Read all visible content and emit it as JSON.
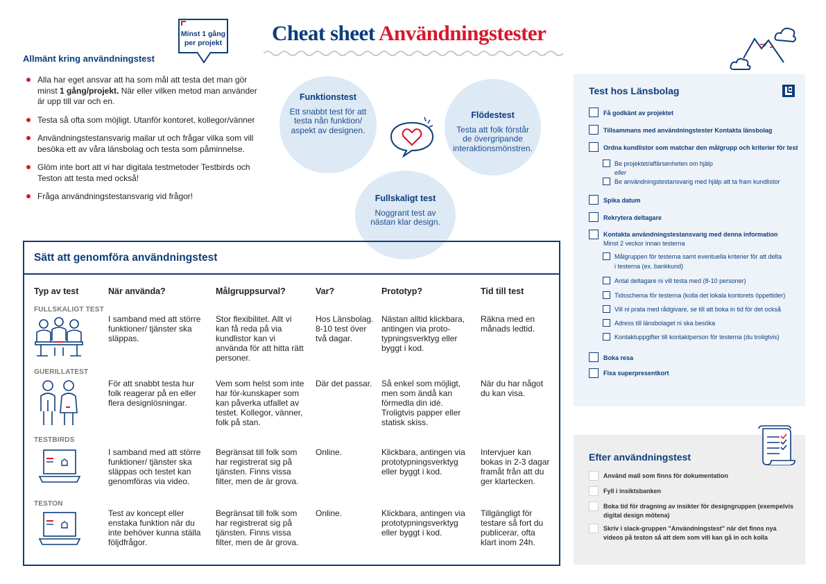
{
  "badge": {
    "line1": "Minst 1 gång",
    "line2": "per projekt"
  },
  "title": {
    "part1": "Cheat sheet",
    "part2": "Användningstester"
  },
  "general": {
    "title": "Allmänt kring användningstest",
    "b1_pre": "Alla har eget ansvar att ha som mål att testa det man gör minst ",
    "b1_bold": "1 gång/projekt.",
    "b1_post": " När eller vilken metod man använder är upp till var och en.",
    "b2": "Testa så ofta som möjligt. Utanför kontoret, kollegor/vänner",
    "b3": "Användningstestansvarig mailar ut och frågar vilka som vill besöka ett av våra länsbolag och testa som påminnelse.",
    "b4": "Glöm inte bort att vi har digitala testmetoder Testbirds och Teston att testa med också!",
    "b5": "Fråga användningstestansvarig vid frågor!"
  },
  "circles": {
    "funktion": {
      "title": "Funktionstest",
      "text": "Ett snabbt test för att testa nån funktion/ aspekt av designen."
    },
    "flode": {
      "title": "Flödestest",
      "text": "Testa att folk förstår de övergripande interaktionsmönstren."
    },
    "full": {
      "title": "Fullskaligt test",
      "text": "Noggrant test av nästan klar design."
    }
  },
  "method": {
    "title": "Sätt att genomföra användningstest",
    "headers": [
      "Typ av test",
      "När använda?",
      "Målgruppsurval?",
      "Var?",
      "Prototyp?",
      "Tid till test"
    ],
    "rows": [
      {
        "label": "FULLSKALIGT TEST",
        "icon": "people-at-table-icon",
        "nar": "I samband med att större funktioner/ tjänster ska släppas.",
        "malgrupp": "Stor flexibilitet. Allt vi kan få reda på via kundlistor kan vi använda för att hitta rätt personer.",
        "var": "Hos Länsbolag. 8-10 test över två dagar.",
        "prototyp": "Nästan alltid klickbara, antingen via proto-typningsverktyg eller byggt i kod.",
        "tid": "Räkna med en månads ledtid."
      },
      {
        "label": "GUERILLATEST",
        "icon": "two-people-icon",
        "nar": "För att snabbt testa hur folk reagerar på en eller flera designlösningar.",
        "malgrupp": "Vem som helst som inte har för-kunskaper som kan påverka utfallet av testet. Kollegor, vänner, folk på stan.",
        "var": "Där det passar.",
        "prototyp": "Så enkel som möjligt, men som ändå kan förmedla din idé. Troligtvis papper eller statisk skiss.",
        "tid": "När du har något du kan visa."
      },
      {
        "label": "TESTBIRDS",
        "icon": "laptop-icon",
        "nar": "I samband med att större funktioner/ tjänster ska släppas och testet  kan genomföras via video.",
        "malgrupp": "Begränsat till folk som har registrerat sig på tjänsten. Finns vissa filter, men de är grova.",
        "var": "Online.",
        "prototyp": "Klickbara, antingen via prototypningsverktyg eller byggt i kod.",
        "tid": "Intervjuer kan bokas in 2-3 dagar framåt från att du ger klartecken."
      },
      {
        "label": "TESTON",
        "icon": "laptop-icon",
        "nar": "Test av koncept eller enstaka funktion när du inte behöver kunna ställa följdfrågor.",
        "malgrupp": "Begränsat till folk som har registrerat sig på tjänsten. Finns vissa filter, men de är grova.",
        "var": "Online.",
        "prototyp": "Klickbara, antingen via prototypningsverktyg eller byggt i kod.",
        "tid": "Tillgängligt för testare så fort du publicerar, ofta klart inom 24h."
      }
    ]
  },
  "lansbolag": {
    "title": "Test hos Länsbolag",
    "i1": "Få godkänt av projektet",
    "i2": "Tillsammans med användningstester Kontakta länsbolag",
    "i3": "Ordna kundlistor som matchar den målgrupp och kriterier för test",
    "i3a": "Be projektet/affärsenheten om hjälp",
    "eller": "eller",
    "i3b": "Be användningstestansvarig med hjälp att ta fram kundlistor",
    "i4": "Spika datum",
    "i5": "Rekrytera deltagare",
    "i6": "Kontakta användningstestansvarig med denna information",
    "i6note": "Minst 2 veckor innan testerna",
    "i6a1": "Målgruppen för testerna samt eventuella kriterier för att delta",
    "i6a2": "i testerna (ex. bankkund)",
    "i6b": "Antal deltagare ni vill testa med (8-10 personer)",
    "i6c": "Tidsschema för testerna (kolla det lokala kontorets öppettider)",
    "i6d": "Vill ni prata med rådgivare, se till att boka in tid för det också",
    "i6e": "Adress till länsbolaget ni ska besöka",
    "i6f": "Kontaktuppgifter till kontaktperson för testerna (du troligtvis)",
    "i7": "Boka resa",
    "i8": "Fixa superpresentkort"
  },
  "efter": {
    "title": "Efter användningstest",
    "i1": "Använd mall som finns för dokumentation",
    "i2": "Fyll i insiktsbanken",
    "i3a": "Boka tid för dragning av insikter för designgruppen (exempelvis",
    "i3b": "digital design mötena)",
    "i4a": "Skriv i slack-gruppen \"Användningstest\" när det finns nya",
    "i4b": "videos på teston så att dem som vill kan gå in och kolla"
  },
  "colors": {
    "navy": "#0d3d7a",
    "red": "#d8182e",
    "light_blue": "#dde9f5",
    "panel_blue": "#eef3fa",
    "panel_grey": "#eeeeee"
  }
}
